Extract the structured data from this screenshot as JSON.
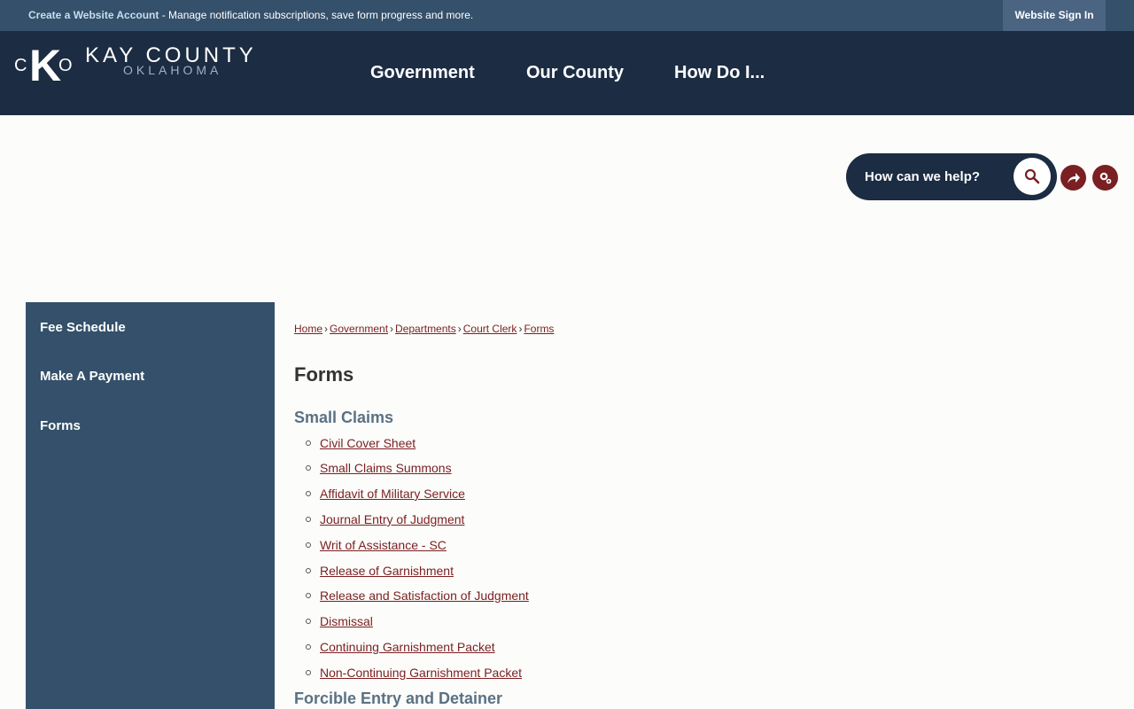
{
  "topbar": {
    "create_account": "Create a Website Account",
    "message": " - Manage notification subscriptions, save form progress and more.",
    "signin": "Website Sign In"
  },
  "logo": {
    "c": "C",
    "k": "K",
    "o": "O",
    "name": "KAY COUNTY",
    "state": "OKLAHOMA"
  },
  "nav": {
    "government": "Government",
    "our_county": "Our County",
    "how_do_i": "How Do I..."
  },
  "search": {
    "placeholder": "How can we help?"
  },
  "sidebar": {
    "items": [
      "Fee Schedule",
      "Make A Payment",
      "Forms"
    ]
  },
  "breadcrumb": {
    "items": [
      "Home",
      "Government",
      "Departments",
      "Court Clerk",
      "Forms"
    ],
    "separator": "›"
  },
  "page": {
    "title": "Forms",
    "section1": "Small Claims",
    "links": [
      "Civil Cover Sheet",
      "Small Claims Summons",
      "Affidavit of Military Service",
      "Journal Entry of Judgment",
      "Writ of Assistance - SC",
      "Release of Garnishment",
      "Release and Satisfaction of Judgment",
      "Dismissal",
      "Continuing Garnishment Packet",
      "Non-Continuing Garnishment Packet"
    ],
    "section2": "Forcible Entry and Detainer"
  },
  "colors": {
    "topbar": "#34506a",
    "header": "#1b2c43",
    "accent": "#7a1f22",
    "sidebar": "#34506a"
  },
  "icons": {
    "search": "search-icon",
    "share": "share-icon",
    "tools": "gears-icon"
  }
}
